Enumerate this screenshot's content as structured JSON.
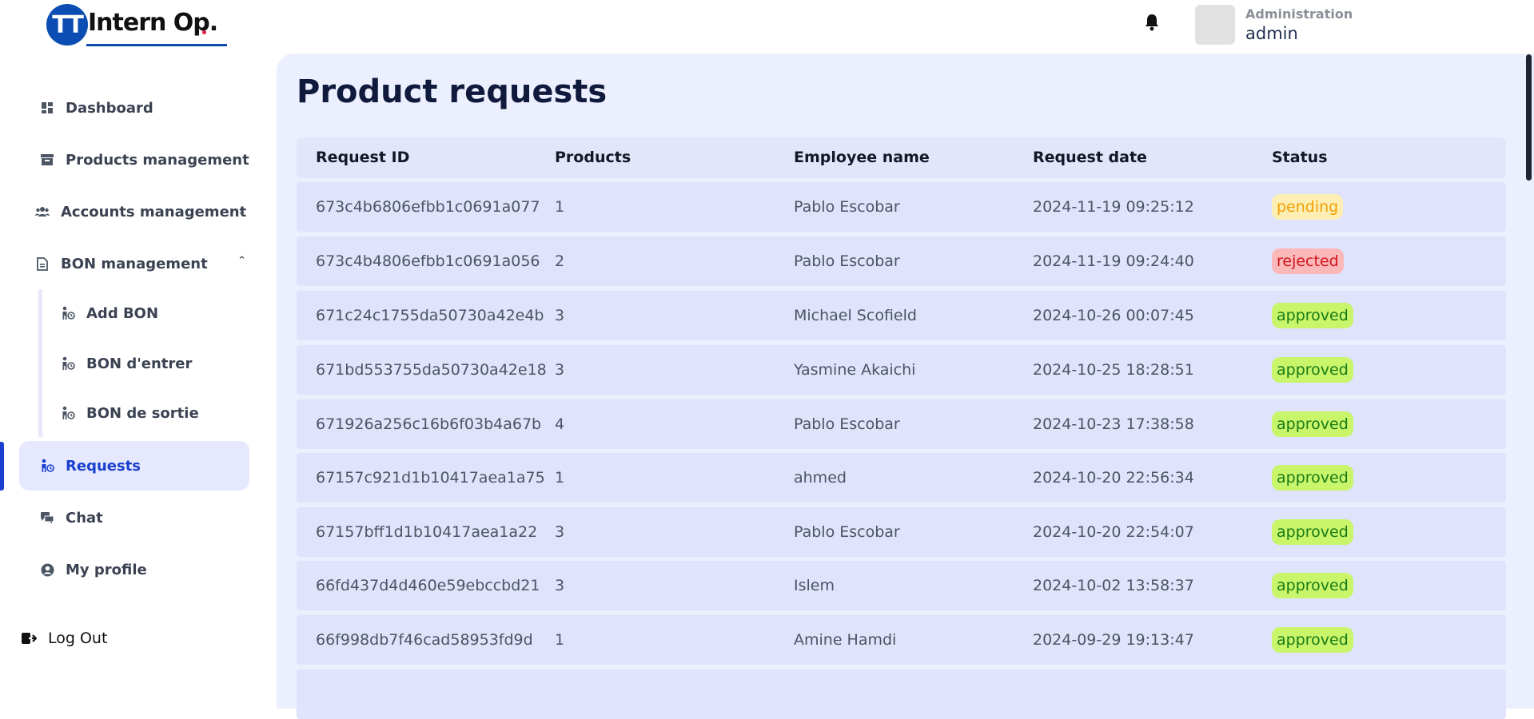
{
  "app": {
    "logo_mark": "TT",
    "logo_text": "Intern Op."
  },
  "header": {
    "user_role": "Administration",
    "user_name": "admin"
  },
  "sidebar": {
    "items": [
      {
        "label": "Dashboard",
        "icon": "dashboard-icon"
      },
      {
        "label": "Products management",
        "icon": "archive-icon"
      },
      {
        "label": "Accounts management",
        "icon": "users-icon"
      },
      {
        "label": "BON management",
        "icon": "document-icon"
      },
      {
        "label": "Requests",
        "icon": "person-request-icon"
      },
      {
        "label": "Chat",
        "icon": "chat-icon"
      },
      {
        "label": "My profile",
        "icon": "user-circle-icon"
      }
    ],
    "bon_subitems": [
      {
        "label": "Add BON"
      },
      {
        "label": "BON d'entrer"
      },
      {
        "label": "BON de sortie"
      }
    ],
    "logout_label": "Log Out"
  },
  "main": {
    "title": "Product requests",
    "columns": [
      "Request ID",
      "Products",
      "Employee name",
      "Request date",
      "Status"
    ],
    "rows": [
      {
        "id": "673c4b6806efbb1c0691a077",
        "products": "1",
        "employee": "Pablo Escobar",
        "date": "2024-11-19 09:25:12",
        "status": "pending"
      },
      {
        "id": "673c4b4806efbb1c0691a056",
        "products": "2",
        "employee": "Pablo Escobar",
        "date": "2024-11-19 09:24:40",
        "status": "rejected"
      },
      {
        "id": "671c24c1755da50730a42e4b",
        "products": "3",
        "employee": "Michael Scofield",
        "date": "2024-10-26 00:07:45",
        "status": "approved"
      },
      {
        "id": "671bd553755da50730a42e18",
        "products": "3",
        "employee": "Yasmine Akaichi",
        "date": "2024-10-25 18:28:51",
        "status": "approved"
      },
      {
        "id": "671926a256c16b6f03b4a67b",
        "products": "4",
        "employee": "Pablo Escobar",
        "date": "2024-10-23 17:38:58",
        "status": "approved"
      },
      {
        "id": "67157c921d1b10417aea1a75",
        "products": "1",
        "employee": "ahmed",
        "date": "2024-10-20 22:56:34",
        "status": "approved"
      },
      {
        "id": "67157bff1d1b10417aea1a22",
        "products": "3",
        "employee": "Pablo Escobar",
        "date": "2024-10-20 22:54:07",
        "status": "approved"
      },
      {
        "id": "66fd437d4d460e59ebccbd21",
        "products": "3",
        "employee": "Islem",
        "date": "2024-10-02 13:58:37",
        "status": "approved"
      },
      {
        "id": "66f998db7f46cad58953fd9d",
        "products": "1",
        "employee": "Amine Hamdi",
        "date": "2024-09-29 19:13:47",
        "status": "approved"
      }
    ]
  },
  "colors": {
    "accent": "#1a3fd0",
    "panel_bg": "#eceffd",
    "pending_bg": "#fdefb3",
    "pending_text": "#f29f05",
    "rejected_bg": "#fbb8b8",
    "rejected_text": "#d3121b",
    "approved_bg": "#c8f56a",
    "approved_text": "#187a16"
  }
}
